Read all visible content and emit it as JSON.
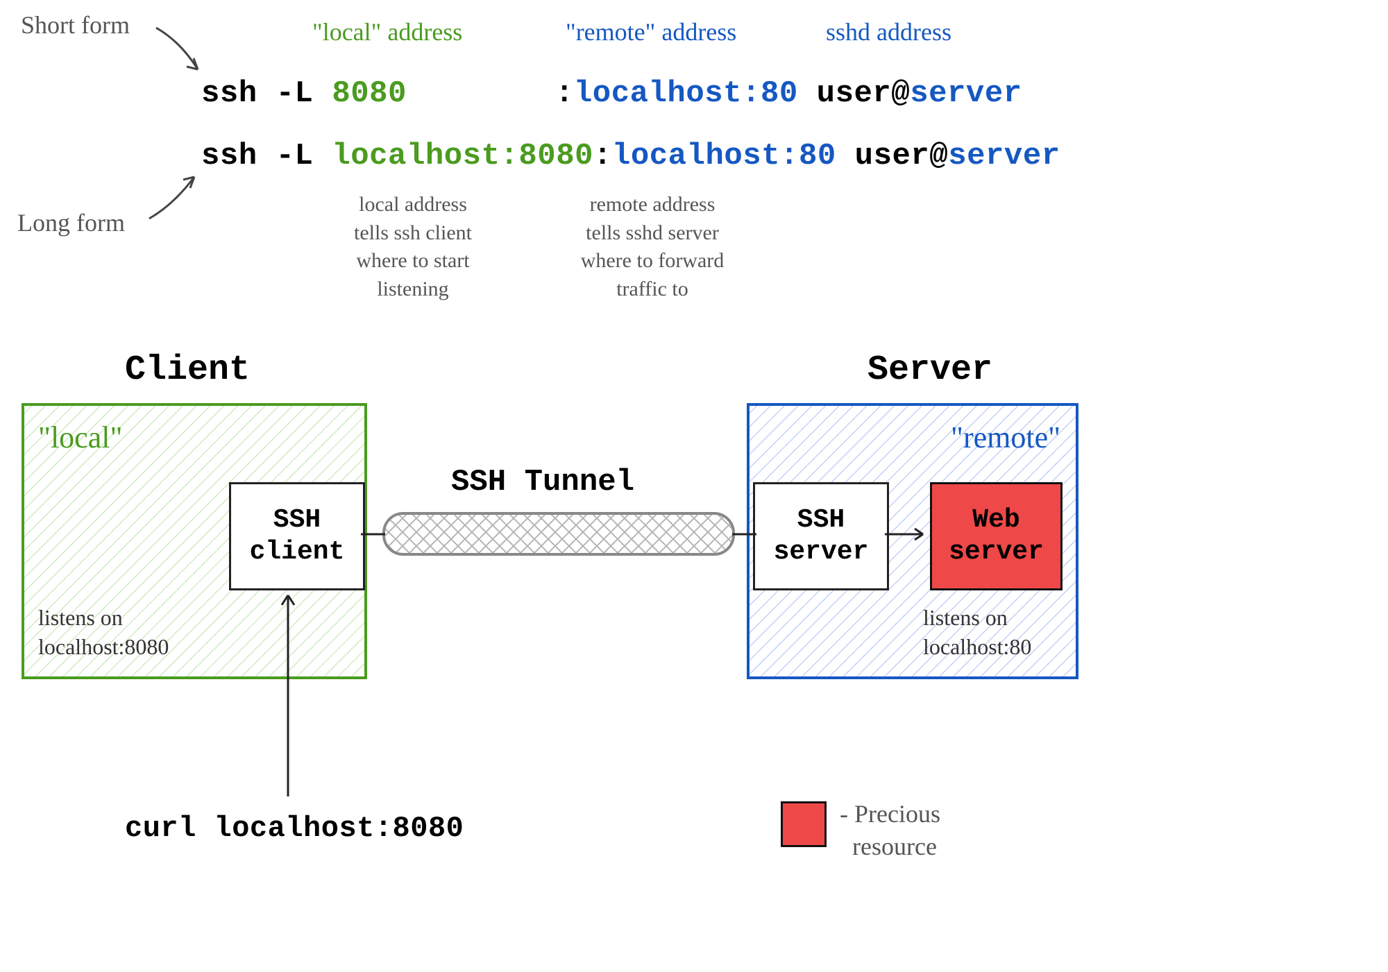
{
  "annotations": {
    "short_form": "Short form",
    "long_form": "Long form",
    "local_addr_header": "\"local\" address",
    "remote_addr_header": "\"remote\" address",
    "sshd_addr_header": "sshd address",
    "local_addr_expl": "local address\ntells ssh client\nwhere to start\nlistening",
    "remote_addr_expl": "remote address\ntells sshd server\nwhere to forward\ntraffic to"
  },
  "cmd": {
    "prefix": "ssh -L ",
    "short_local": "8080",
    "long_local": "localhost:8080",
    "colon": ":",
    "remote": "localhost:80",
    "user_at": " user@",
    "server": "server"
  },
  "diagram": {
    "client_title": "Client",
    "server_title": "Server",
    "local_label": "\"local\"",
    "remote_label": "\"remote\"",
    "ssh_client": "SSH\nclient",
    "ssh_server": "SSH\nserver",
    "web_server": "Web\nserver",
    "tunnel_label": "SSH Tunnel",
    "client_listens": "listens on\nlocalhost:8080",
    "server_listens": "listens on\nlocalhost:80",
    "curl_cmd": "curl localhost:8080",
    "legend": "- Precious\n  resource"
  }
}
